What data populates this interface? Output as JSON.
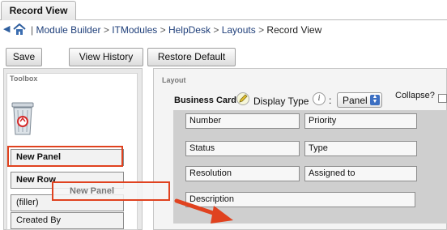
{
  "tab": {
    "label": "Record View"
  },
  "breadcrumb": {
    "separator_pipe": "|",
    "items": [
      "Module Builder",
      "ITModules",
      "HelpDesk",
      "Layouts"
    ],
    "arrow": ">",
    "current": "Record View"
  },
  "toolbar": {
    "save_label": "Save",
    "history_label": "View History",
    "restore_label": "Restore Default"
  },
  "toolbox": {
    "title": "Toolbox",
    "new_panel": "New Panel",
    "new_row": "New Row",
    "filler": "(filler)",
    "created_by": "Created By"
  },
  "drag": {
    "label": "New Panel"
  },
  "layout": {
    "title": "Layout",
    "panel_name": "Business Card",
    "display_type_label": "Display Type",
    "colon": ":",
    "display_type_value": "Panel",
    "collapse_label": "Collapse?",
    "fields": [
      [
        "Number",
        "Priority"
      ],
      [
        "Status",
        "Type"
      ],
      [
        "Resolution",
        "Assigned to"
      ]
    ],
    "wide_field": "Description"
  },
  "colors": {
    "highlight": "#e0421f"
  }
}
